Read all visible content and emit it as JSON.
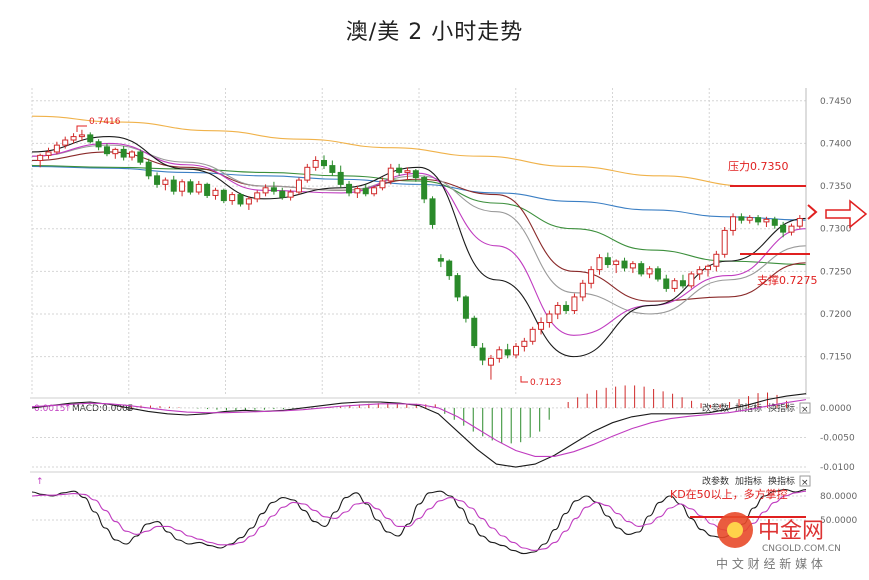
{
  "title": "澳/美 2 小时走势",
  "colors": {
    "up": "#d02a2a",
    "down": "#2a8a2a",
    "ma_yellow": "#f0b24a",
    "ma_blue": "#3b7fc4",
    "ma_green": "#3c8f3c",
    "ma_black": "#1a1a1a",
    "ma_magenta": "#c03cc0",
    "ma_brown": "#8a2a2a",
    "ma_gray": "#9a9a9a",
    "annotation": "#e02020",
    "grid": "#d6d6d6"
  },
  "panels": {
    "macd": {
      "label_value": "0.0015",
      "label_arrow_up": "↑",
      "label_name": "MACD:0.0005",
      "label_arrow_down": "↓",
      "buttons": [
        "改参数",
        "加指标",
        "换指标"
      ],
      "close": "×"
    },
    "kd": {
      "label_arrow_up": "↑",
      "buttons": [
        "改参数",
        "加指标",
        "换指标"
      ],
      "close": "×"
    }
  },
  "annotations": {
    "high_label": "0.7416",
    "low_label": "0.7123",
    "resistance": "压力0.7350",
    "support": "支撑0.7275",
    "kd_note": "KD在50以上，多方掌控"
  },
  "watermark": {
    "brand": "中金网",
    "site": "CNGOLD.COM.CN",
    "tagline": "中 文 财 经 新 媒 体"
  },
  "chart_data": [
    {
      "type": "candlestick",
      "name": "price",
      "y_ticks": [
        "0.7450",
        "0.7400",
        "0.7350",
        "0.7300",
        "0.7250",
        "0.7200",
        "0.7150"
      ],
      "ylim": [
        0.7105,
        0.7465
      ],
      "grid": true,
      "candles": [
        [
          0.738,
          0.7388,
          0.7372,
          0.7386
        ],
        [
          0.7386,
          0.7395,
          0.7382,
          0.739
        ],
        [
          0.739,
          0.7402,
          0.7387,
          0.7398
        ],
        [
          0.7398,
          0.7408,
          0.7394,
          0.7404
        ],
        [
          0.7404,
          0.7412,
          0.74,
          0.7408
        ],
        [
          0.7408,
          0.7416,
          0.7403,
          0.741
        ],
        [
          0.741,
          0.7413,
          0.74,
          0.7402
        ],
        [
          0.7402,
          0.7405,
          0.7392,
          0.7396
        ],
        [
          0.7396,
          0.74,
          0.7385,
          0.7388
        ],
        [
          0.7388,
          0.7395,
          0.7382,
          0.7393
        ],
        [
          0.7393,
          0.7397,
          0.738,
          0.7384
        ],
        [
          0.7384,
          0.7392,
          0.738,
          0.739
        ],
        [
          0.739,
          0.7393,
          0.7375,
          0.7378
        ],
        [
          0.7378,
          0.7382,
          0.7358,
          0.7362
        ],
        [
          0.7362,
          0.7366,
          0.7348,
          0.7352
        ],
        [
          0.7352,
          0.736,
          0.7345,
          0.7357
        ],
        [
          0.7357,
          0.7362,
          0.734,
          0.7344
        ],
        [
          0.7344,
          0.7358,
          0.7338,
          0.7355
        ],
        [
          0.7355,
          0.7358,
          0.734,
          0.7343
        ],
        [
          0.7343,
          0.7356,
          0.734,
          0.7352
        ],
        [
          0.7352,
          0.7354,
          0.7336,
          0.7339
        ],
        [
          0.7339,
          0.7348,
          0.7334,
          0.7345
        ],
        [
          0.7345,
          0.7347,
          0.733,
          0.7333
        ],
        [
          0.7333,
          0.7343,
          0.7328,
          0.734
        ],
        [
          0.734,
          0.7342,
          0.7326,
          0.7329
        ],
        [
          0.7329,
          0.7338,
          0.7322,
          0.7335
        ],
        [
          0.7335,
          0.7345,
          0.7331,
          0.7342
        ],
        [
          0.7342,
          0.7352,
          0.7338,
          0.7348
        ],
        [
          0.7348,
          0.7355,
          0.734,
          0.7344
        ],
        [
          0.7344,
          0.7348,
          0.7334,
          0.7337
        ],
        [
          0.7337,
          0.7346,
          0.7333,
          0.7343
        ],
        [
          0.7343,
          0.736,
          0.734,
          0.7357
        ],
        [
          0.7357,
          0.7376,
          0.7354,
          0.7372
        ],
        [
          0.7372,
          0.7385,
          0.7368,
          0.738
        ],
        [
          0.738,
          0.7386,
          0.737,
          0.7374
        ],
        [
          0.7374,
          0.738,
          0.7362,
          0.7366
        ],
        [
          0.7366,
          0.7374,
          0.7348,
          0.7352
        ],
        [
          0.7352,
          0.7356,
          0.7338,
          0.7342
        ],
        [
          0.7342,
          0.735,
          0.7336,
          0.7347
        ],
        [
          0.7347,
          0.7352,
          0.7338,
          0.7341
        ],
        [
          0.7341,
          0.735,
          0.7338,
          0.7348
        ],
        [
          0.7348,
          0.736,
          0.7345,
          0.7356
        ],
        [
          0.7356,
          0.7376,
          0.7352,
          0.7371
        ],
        [
          0.7371,
          0.7376,
          0.7362,
          0.7366
        ],
        [
          0.7366,
          0.7372,
          0.7358,
          0.7368
        ],
        [
          0.7368,
          0.737,
          0.7355,
          0.736
        ],
        [
          0.736,
          0.7362,
          0.733,
          0.7335
        ],
        [
          0.7335,
          0.7338,
          0.73,
          0.7305
        ],
        [
          0.7265,
          0.727,
          0.7255,
          0.7262
        ],
        [
          0.7262,
          0.7264,
          0.724,
          0.7245
        ],
        [
          0.7245,
          0.7248,
          0.7215,
          0.722
        ],
        [
          0.722,
          0.7222,
          0.719,
          0.7195
        ],
        [
          0.7195,
          0.7198,
          0.716,
          0.7163
        ],
        [
          0.716,
          0.7166,
          0.714,
          0.7146
        ],
        [
          0.714,
          0.7152,
          0.7123,
          0.7148
        ],
        [
          0.7148,
          0.7162,
          0.7143,
          0.7158
        ],
        [
          0.7158,
          0.7165,
          0.7148,
          0.7152
        ],
        [
          0.7152,
          0.7166,
          0.7148,
          0.7162
        ],
        [
          0.7162,
          0.7172,
          0.7156,
          0.7168
        ],
        [
          0.7168,
          0.7185,
          0.7164,
          0.7182
        ],
        [
          0.7182,
          0.7196,
          0.7176,
          0.719
        ],
        [
          0.719,
          0.7204,
          0.7184,
          0.72
        ],
        [
          0.72,
          0.7214,
          0.7194,
          0.721
        ],
        [
          0.721,
          0.7215,
          0.72,
          0.7204
        ],
        [
          0.7204,
          0.7224,
          0.72,
          0.722
        ],
        [
          0.722,
          0.724,
          0.7215,
          0.7236
        ],
        [
          0.7236,
          0.7256,
          0.723,
          0.7252
        ],
        [
          0.7252,
          0.727,
          0.7246,
          0.7266
        ],
        [
          0.7266,
          0.7272,
          0.7254,
          0.7258
        ],
        [
          0.7258,
          0.7264,
          0.7248,
          0.7262
        ],
        [
          0.7262,
          0.7266,
          0.725,
          0.7254
        ],
        [
          0.7254,
          0.7262,
          0.7248,
          0.7259
        ],
        [
          0.7259,
          0.7262,
          0.7244,
          0.7247
        ],
        [
          0.7247,
          0.7256,
          0.7242,
          0.7253
        ],
        [
          0.7253,
          0.7256,
          0.7238,
          0.7241
        ],
        [
          0.7241,
          0.7246,
          0.7226,
          0.723
        ],
        [
          0.723,
          0.7242,
          0.7226,
          0.7239
        ],
        [
          0.7239,
          0.7246,
          0.723,
          0.7233
        ],
        [
          0.7233,
          0.725,
          0.723,
          0.7247
        ],
        [
          0.7247,
          0.7256,
          0.724,
          0.7252
        ],
        [
          0.7252,
          0.7258,
          0.7244,
          0.7256
        ],
        [
          0.7256,
          0.7274,
          0.725,
          0.727
        ],
        [
          0.727,
          0.7302,
          0.7266,
          0.7298
        ],
        [
          0.7298,
          0.7318,
          0.7292,
          0.7314
        ],
        [
          0.7314,
          0.7318,
          0.7306,
          0.731
        ],
        [
          0.731,
          0.7316,
          0.7306,
          0.7313
        ],
        [
          0.7313,
          0.7316,
          0.7304,
          0.7308
        ],
        [
          0.7308,
          0.7314,
          0.7302,
          0.7311
        ],
        [
          0.7311,
          0.7314,
          0.73,
          0.7304
        ],
        [
          0.7304,
          0.7308,
          0.729,
          0.7296
        ],
        [
          0.7296,
          0.7306,
          0.7292,
          0.7303
        ],
        [
          0.7303,
          0.7316,
          0.73,
          0.7312
        ]
      ],
      "ma_lines": [
        {
          "color": "ma_yellow",
          "values": [
            0.7432,
            0.7425,
            0.7415,
            0.7405,
            0.7395,
            0.7385,
            0.7373,
            0.7362,
            0.735
          ]
        },
        {
          "color": "ma_blue",
          "values": [
            0.7373,
            0.7371,
            0.7366,
            0.7362,
            0.7358,
            0.7352,
            0.7342,
            0.7332,
            0.7322,
            0.7314,
            0.731
          ]
        },
        {
          "color": "ma_green",
          "values": [
            0.7374,
            0.7372,
            0.737,
            0.7366,
            0.7362,
            0.7356,
            0.733,
            0.73,
            0.7275,
            0.7262,
            0.7258
          ]
        },
        {
          "color": "ma_brown",
          "values": [
            0.738,
            0.739,
            0.7372,
            0.735,
            0.7345,
            0.7358,
            0.734,
            0.725,
            0.7215,
            0.722,
            0.726
          ]
        },
        {
          "color": "ma_gray",
          "values": [
            0.7385,
            0.7398,
            0.7378,
            0.735,
            0.7345,
            0.7362,
            0.732,
            0.7225,
            0.72,
            0.724,
            0.728
          ]
        },
        {
          "color": "ma_magenta",
          "values": [
            0.7385,
            0.74,
            0.7375,
            0.7345,
            0.7342,
            0.7365,
            0.728,
            0.7175,
            0.721,
            0.7245,
            0.73
          ]
        },
        {
          "color": "ma_black",
          "values": [
            0.739,
            0.7408,
            0.737,
            0.7335,
            0.7348,
            0.7372,
            0.724,
            0.715,
            0.721,
            0.7262,
            0.7312
          ]
        }
      ],
      "levels": {
        "resistance": 0.735,
        "support": 0.7275
      }
    },
    {
      "type": "bar",
      "name": "MACD",
      "y_ticks": [
        "0.0000",
        "-0.0050",
        "-0.0100"
      ],
      "ylim": [
        -0.0105,
        0.001
      ],
      "histogram": [
        0.0002,
        0.0003,
        0.0004,
        0.0004,
        0.0003,
        0.0002,
        0.0001,
        0.0,
        -0.0001,
        -0.0002,
        -0.0003,
        -0.0004,
        -0.0004,
        -0.0004,
        -0.0003,
        -0.0003,
        -0.0002,
        -0.0002,
        -0.0001,
        -0.0001,
        -0.0001,
        0.0,
        0.0001,
        0.0003,
        0.0005,
        0.0006,
        0.0007,
        0.0008,
        0.0008,
        0.0007,
        0.0007,
        0.0007,
        0.0006,
        0.0006,
        -0.001,
        -0.002,
        -0.003,
        -0.004,
        -0.0048,
        -0.0055,
        -0.006,
        -0.006,
        -0.0058,
        -0.005,
        -0.004,
        -0.002,
        0.0,
        0.001,
        0.0018,
        0.0024,
        0.003,
        0.0034,
        0.0036,
        0.0038,
        0.0038,
        0.0036,
        0.0032,
        0.0028,
        0.0024,
        0.0018,
        0.0012,
        0.0008,
        0.0005,
        0.0006,
        0.001,
        0.0015,
        0.002,
        0.0025,
        0.0026,
        0.0022,
        0.0012
      ],
      "dif": [
        0.0,
        0.0004,
        0.0008,
        0.001,
        0.0006,
        0.0,
        -0.0006,
        -0.001,
        -0.0012,
        -0.001,
        -0.0006,
        -0.0004,
        -0.0006,
        -0.0004,
        0.0,
        0.0004,
        0.0008,
        0.001,
        0.001,
        0.0008,
        0.0004,
        -0.001,
        -0.004,
        -0.007,
        -0.0095,
        -0.01,
        -0.0095,
        -0.008,
        -0.006,
        -0.004,
        -0.0025,
        -0.0015,
        -0.001,
        -0.001,
        -0.001,
        -0.0008,
        -0.0002,
        0.0005,
        0.0014,
        0.002,
        0.0024
      ],
      "dea": [
        0.0002,
        0.0004,
        0.0006,
        0.0008,
        0.0007,
        0.0004,
        0.0,
        -0.0004,
        -0.0007,
        -0.0008,
        -0.0008,
        -0.0007,
        -0.0006,
        -0.0005,
        -0.0003,
        0.0,
        0.0003,
        0.0005,
        0.0007,
        0.0007,
        0.0006,
        0.0,
        -0.0015,
        -0.0035,
        -0.0055,
        -0.0072,
        -0.0082,
        -0.0082,
        -0.0074,
        -0.0062,
        -0.0048,
        -0.0035,
        -0.0025,
        -0.0018,
        -0.0014,
        -0.0011,
        -0.0008,
        -0.0003,
        0.0003,
        0.0009,
        0.0014
      ]
    },
    {
      "type": "line",
      "name": "KD",
      "y_ticks": [
        "80.0000",
        "50.0000"
      ],
      "ylim": [
        0,
        100
      ],
      "k": [
        85,
        82,
        80,
        84,
        86,
        78,
        60,
        40,
        25,
        20,
        30,
        45,
        48,
        35,
        25,
        20,
        22,
        18,
        15,
        20,
        28,
        40,
        58,
        72,
        78,
        75,
        62,
        48,
        42,
        60,
        78,
        84,
        70,
        50,
        35,
        30,
        45,
        70,
        84,
        86,
        80,
        65,
        45,
        30,
        22,
        18,
        12,
        8,
        10,
        20,
        38,
        58,
        74,
        80,
        72,
        55,
        40,
        32,
        35,
        55,
        72,
        80,
        70,
        52,
        38,
        30,
        28,
        32,
        45,
        65,
        80,
        86,
        88,
        85,
        88
      ],
      "d": [
        80,
        81,
        81,
        82,
        83,
        82,
        75,
        62,
        48,
        36,
        32,
        36,
        42,
        42,
        37,
        30,
        26,
        22,
        19,
        19,
        22,
        30,
        42,
        55,
        66,
        72,
        70,
        62,
        54,
        52,
        60,
        70,
        72,
        64,
        52,
        42,
        42,
        52,
        64,
        74,
        78,
        74,
        65,
        52,
        40,
        30,
        22,
        15,
        12,
        14,
        22,
        36,
        52,
        66,
        72,
        68,
        58,
        48,
        42,
        45,
        54,
        65,
        70,
        64,
        55,
        45,
        38,
        34,
        36,
        46,
        60,
        72,
        80,
        84,
        86
      ]
    }
  ]
}
